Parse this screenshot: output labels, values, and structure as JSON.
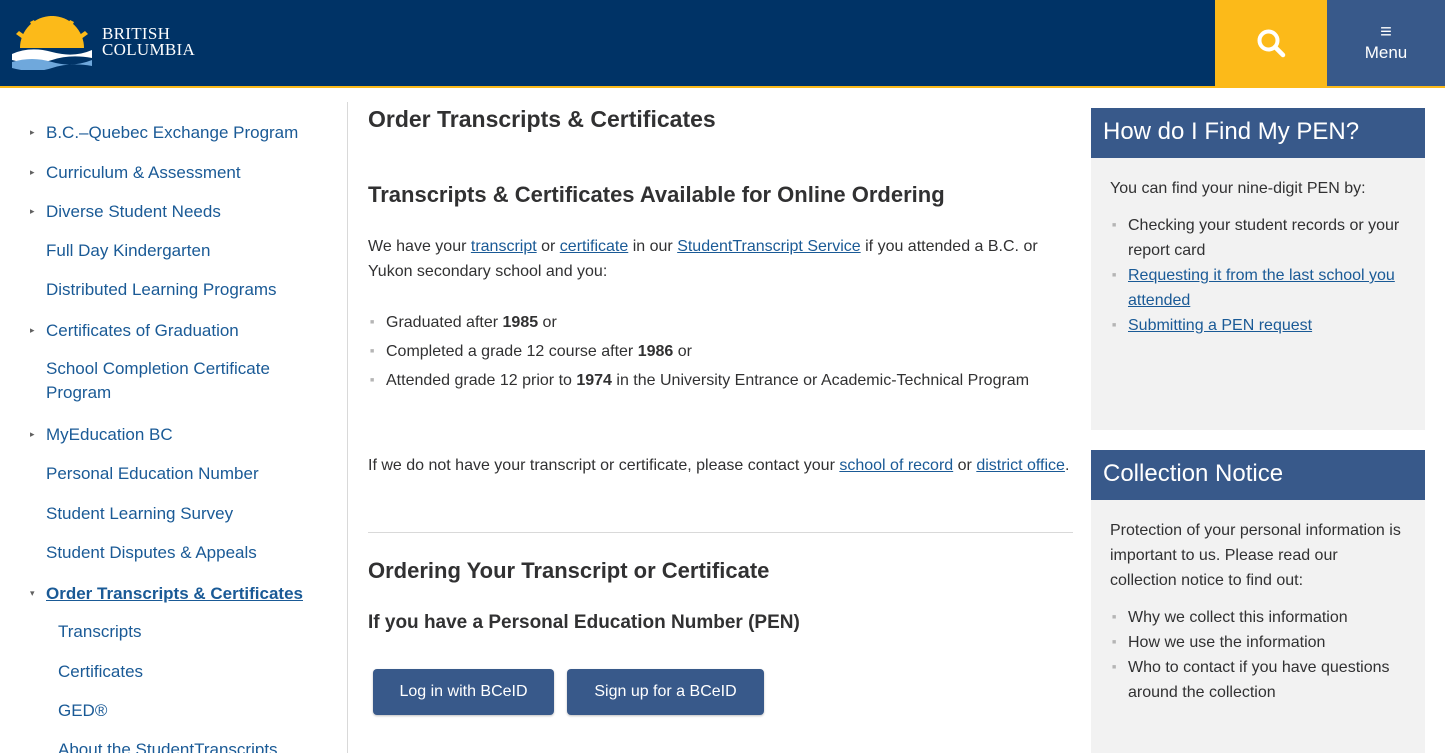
{
  "header": {
    "logo_line1": "BRITISH",
    "logo_line2": "COLUMBIA",
    "menu_label": "Menu",
    "colors": {
      "primary": "#003366",
      "accent": "#fcba19",
      "secondary": "#38598a"
    }
  },
  "leftnav": {
    "items": [
      {
        "label": "B.C.–Quebec Exchange Program",
        "arrow": "▸"
      },
      {
        "label": "Curriculum & Assessment",
        "arrow": "▸"
      },
      {
        "label": "Diverse Student Needs",
        "arrow": "▸"
      },
      {
        "label": "Full Day Kindergarten"
      },
      {
        "label": "Distributed Learning Programs"
      },
      {
        "label": "Certificates of Graduation",
        "arrow": "▸"
      },
      {
        "label": "School Completion Certificate Program"
      },
      {
        "label": "MyEducation BC",
        "arrow": "▸"
      },
      {
        "label": "Personal Education Number"
      },
      {
        "label": "Student Learning Survey"
      },
      {
        "label": "Student Disputes & Appeals"
      },
      {
        "label": "Order Transcripts & Certificates",
        "arrow": "▾"
      },
      {
        "label": "Transcripts"
      },
      {
        "label": "Certificates"
      },
      {
        "label": "GED®"
      },
      {
        "label": "About the StudentTranscripts"
      }
    ]
  },
  "main": {
    "title": "Order Transcripts & Certificates",
    "section1_heading": "Transcripts & Certificates Available for Online Ordering",
    "intro": {
      "t1": "We have your ",
      "link_transcript": "transcript",
      "t2": " or ",
      "link_certificate": "certificate",
      "t3": " in our ",
      "link_service": "StudentTranscript Service",
      "t4": " if you attended a B.C. or Yukon secondary school and you:"
    },
    "bullets": [
      {
        "pre": "Graduated after ",
        "bold": "1985",
        "post": " or"
      },
      {
        "pre": "Completed a grade 12 course after ",
        "bold": "1986",
        "post": " or"
      },
      {
        "pre": "Attended grade 12 prior to ",
        "bold": "1974",
        "post": " in the University Entrance or Academic-Technical Program"
      }
    ],
    "contact": {
      "t1": "If we do not have your transcript or certificate, please contact your ",
      "link_school": "school of record",
      "t2": " or ",
      "link_district": "district office",
      "t3": "."
    },
    "section2_heading": "Ordering Your Transcript or Certificate",
    "pen_heading": "If you have a Personal Education Number (PEN)",
    "login_button": "Log in with BCeID",
    "signup_button": "Sign up for a BCeID"
  },
  "sidebar": {
    "pen_box": {
      "title": "How do I Find My PEN?",
      "intro": "You can find your nine-digit PEN by:",
      "item1": "Checking your student records or your report card",
      "item2": "Requesting it from the last school you attended",
      "item3": "Submitting a PEN request"
    },
    "notice_box": {
      "title": "Collection Notice",
      "intro": "Protection of your personal information is important to us. Please read our collection notice to find out:",
      "item1": "Why we collect this information",
      "item2": "How we use the information",
      "item3": "Who to contact if you have questions around the collection"
    }
  }
}
